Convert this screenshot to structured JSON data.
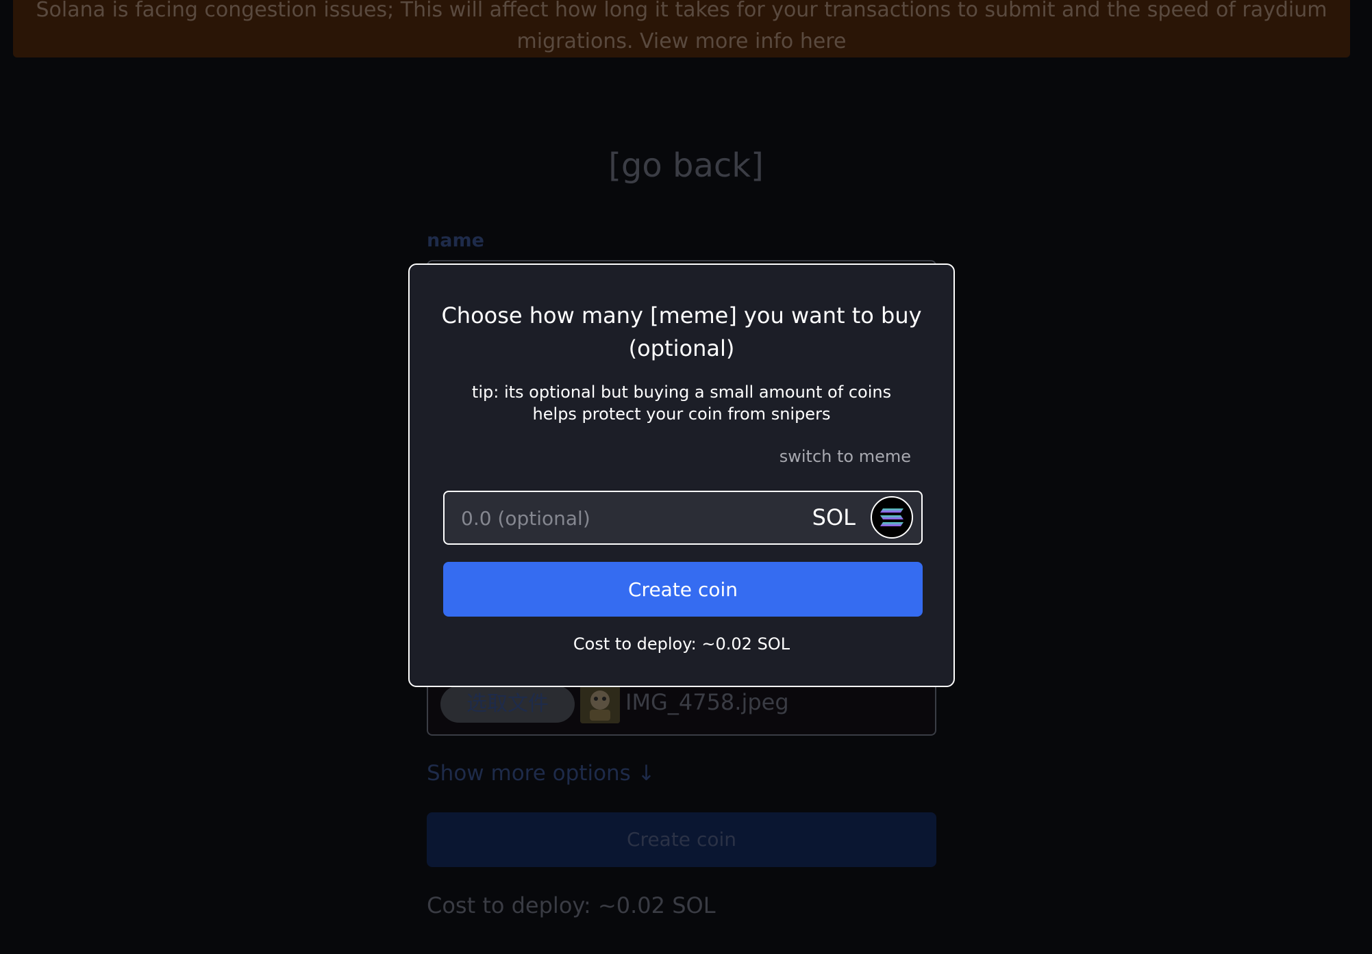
{
  "banner": {
    "message": "Solana is facing congestion issues; This will affect how long it takes for your transactions to submit and the speed of raydium migrations.",
    "link_text": "View more info here"
  },
  "background_form": {
    "go_back": "[go back]",
    "name_label": "name",
    "file_button": "选取文件",
    "file_name": "IMG_4758.jpeg",
    "more_options": "Show more options ↓",
    "create_button": "Create coin",
    "cost": "Cost to deploy: ~0.02 SOL"
  },
  "modal": {
    "title": "Choose how many [meme] you want to buy (optional)",
    "tip": "tip: its optional but buying a small amount of coins helps protect your coin from snipers",
    "switch_link": "switch to meme",
    "amount_placeholder": "0.0 (optional)",
    "currency": "SOL",
    "currency_icon": "solana-icon",
    "create_button": "Create coin",
    "cost": "Cost to deploy: ~0.02 SOL"
  },
  "colors": {
    "accent": "#356cf1",
    "modal_bg": "#1c1e27",
    "page_bg": "#07080b"
  }
}
